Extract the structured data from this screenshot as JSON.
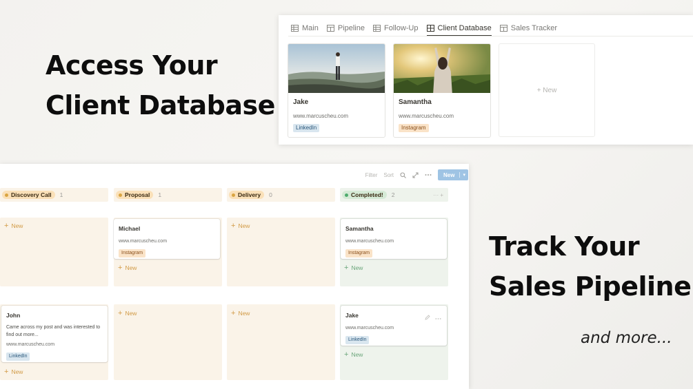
{
  "headline_top": {
    "line1": "Access Your",
    "line2": "Client Database"
  },
  "headline_bottom": {
    "line1": "Track Your",
    "line2": "Sales Pipeline"
  },
  "tagline": "and more...",
  "db_tabs": [
    {
      "label": "Main",
      "icon": "table-icon"
    },
    {
      "label": "Pipeline",
      "icon": "board-icon"
    },
    {
      "label": "Follow-Up",
      "icon": "table-icon"
    },
    {
      "label": "Client Database",
      "icon": "gallery-icon",
      "active": true
    },
    {
      "label": "Sales Tracker",
      "icon": "board-icon"
    }
  ],
  "gallery": [
    {
      "name": "Jake",
      "url": "www.marcuscheu.com",
      "tag": "LinkedIn",
      "tag_type": "linkedin"
    },
    {
      "name": "Samantha",
      "url": "www.marcuscheu.com",
      "tag": "Instagram",
      "tag_type": "instagram"
    }
  ],
  "gallery_new": "+ New",
  "toolbar": {
    "filter": "Filter",
    "sort": "Sort",
    "new": "New"
  },
  "columns": [
    {
      "label": "Discovery Call",
      "count": "1",
      "color": "#d9a441"
    },
    {
      "label": "Proposal",
      "count": "1",
      "color": "#d9a441"
    },
    {
      "label": "Delivery",
      "count": "0",
      "color": "#d9a441"
    },
    {
      "label": "Completed!",
      "count": "2",
      "color": "#4dab6d"
    }
  ],
  "board": {
    "michael": {
      "name": "Michael",
      "url": "www.marcuscheu.com",
      "tag": "Instagram"
    },
    "samantha": {
      "name": "Samantha",
      "url": "www.marcuscheu.com",
      "tag": "Instagram"
    },
    "john": {
      "name": "John",
      "note": "Came across my post and was interested to find out more...",
      "url": "www.marcuscheu.com",
      "tag": "LinkedIn"
    },
    "jake": {
      "name": "Jake",
      "url": "www.marcuscheu.com",
      "tag": "LinkedIn"
    },
    "new_label": "New"
  }
}
